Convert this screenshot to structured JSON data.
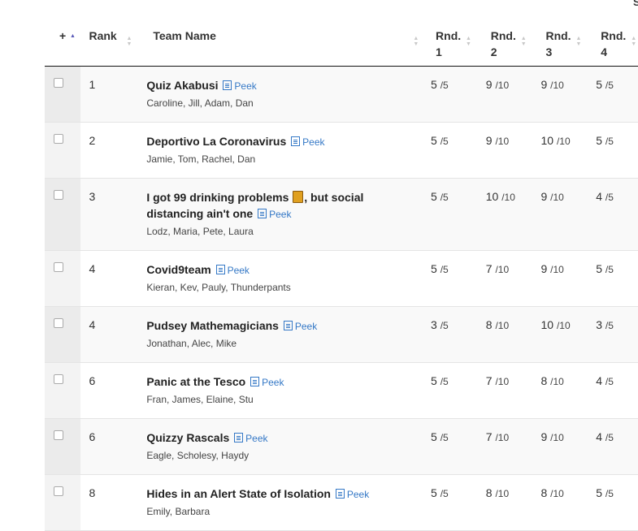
{
  "corner_text": "S",
  "header": {
    "select_label": "+",
    "rank_label": "Rank",
    "team_label": "Team Name",
    "rounds": [
      {
        "line1": "Rnd.",
        "line2": "1"
      },
      {
        "line1": "Rnd.",
        "line2": "2"
      },
      {
        "line1": "Rnd.",
        "line2": "3"
      },
      {
        "line1": "Rnd.",
        "line2": "4"
      }
    ]
  },
  "peek_label": "Peek",
  "rows": [
    {
      "rank": "1",
      "team": "Quiz Akabusi",
      "members": "Caroline, Jill, Adam, Dan",
      "scores": [
        {
          "v": "5",
          "m": "/5"
        },
        {
          "v": "9",
          "m": "/10"
        },
        {
          "v": "9",
          "m": "/10"
        },
        {
          "v": "5",
          "m": "/5"
        }
      ]
    },
    {
      "rank": "2",
      "team": "Deportivo La Coronavirus",
      "members": "Jamie, Tom, Rachel, Dan",
      "scores": [
        {
          "v": "5",
          "m": "/5"
        },
        {
          "v": "9",
          "m": "/10"
        },
        {
          "v": "10",
          "m": "/10"
        },
        {
          "v": "5",
          "m": "/5"
        }
      ]
    },
    {
      "rank": "3",
      "team_part1": "I got 99 drinking problems",
      "team_part2": ", but social distancing ain't one",
      "members": "Lodz, Maria, Pete, Laura",
      "scores": [
        {
          "v": "5",
          "m": "/5"
        },
        {
          "v": "10",
          "m": "/10"
        },
        {
          "v": "9",
          "m": "/10"
        },
        {
          "v": "4",
          "m": "/5"
        }
      ]
    },
    {
      "rank": "4",
      "team": "Covid9team",
      "members": "Kieran, Kev, Pauly, Thunderpants",
      "scores": [
        {
          "v": "5",
          "m": "/5"
        },
        {
          "v": "7",
          "m": "/10"
        },
        {
          "v": "9",
          "m": "/10"
        },
        {
          "v": "5",
          "m": "/5"
        }
      ]
    },
    {
      "rank": "4",
      "team": "Pudsey Mathemagicians",
      "members": "Jonathan, Alec, Mike",
      "scores": [
        {
          "v": "3",
          "m": "/5"
        },
        {
          "v": "8",
          "m": "/10"
        },
        {
          "v": "10",
          "m": "/10"
        },
        {
          "v": "3",
          "m": "/5"
        }
      ]
    },
    {
      "rank": "6",
      "team": "Panic at the Tesco",
      "members": "Fran, James, Elaine, Stu",
      "scores": [
        {
          "v": "5",
          "m": "/5"
        },
        {
          "v": "7",
          "m": "/10"
        },
        {
          "v": "8",
          "m": "/10"
        },
        {
          "v": "4",
          "m": "/5"
        }
      ]
    },
    {
      "rank": "6",
      "team": "Quizzy Rascals",
      "members": "Eagle, Scholesy, Haydy",
      "scores": [
        {
          "v": "5",
          "m": "/5"
        },
        {
          "v": "7",
          "m": "/10"
        },
        {
          "v": "9",
          "m": "/10"
        },
        {
          "v": "4",
          "m": "/5"
        }
      ]
    },
    {
      "rank": "8",
      "team": "Hides in an Alert State of Isolation",
      "members": "Emily, Barbara",
      "scores": [
        {
          "v": "5",
          "m": "/5"
        },
        {
          "v": "8",
          "m": "/10"
        },
        {
          "v": "8",
          "m": "/10"
        },
        {
          "v": "5",
          "m": "/5"
        }
      ]
    }
  ]
}
